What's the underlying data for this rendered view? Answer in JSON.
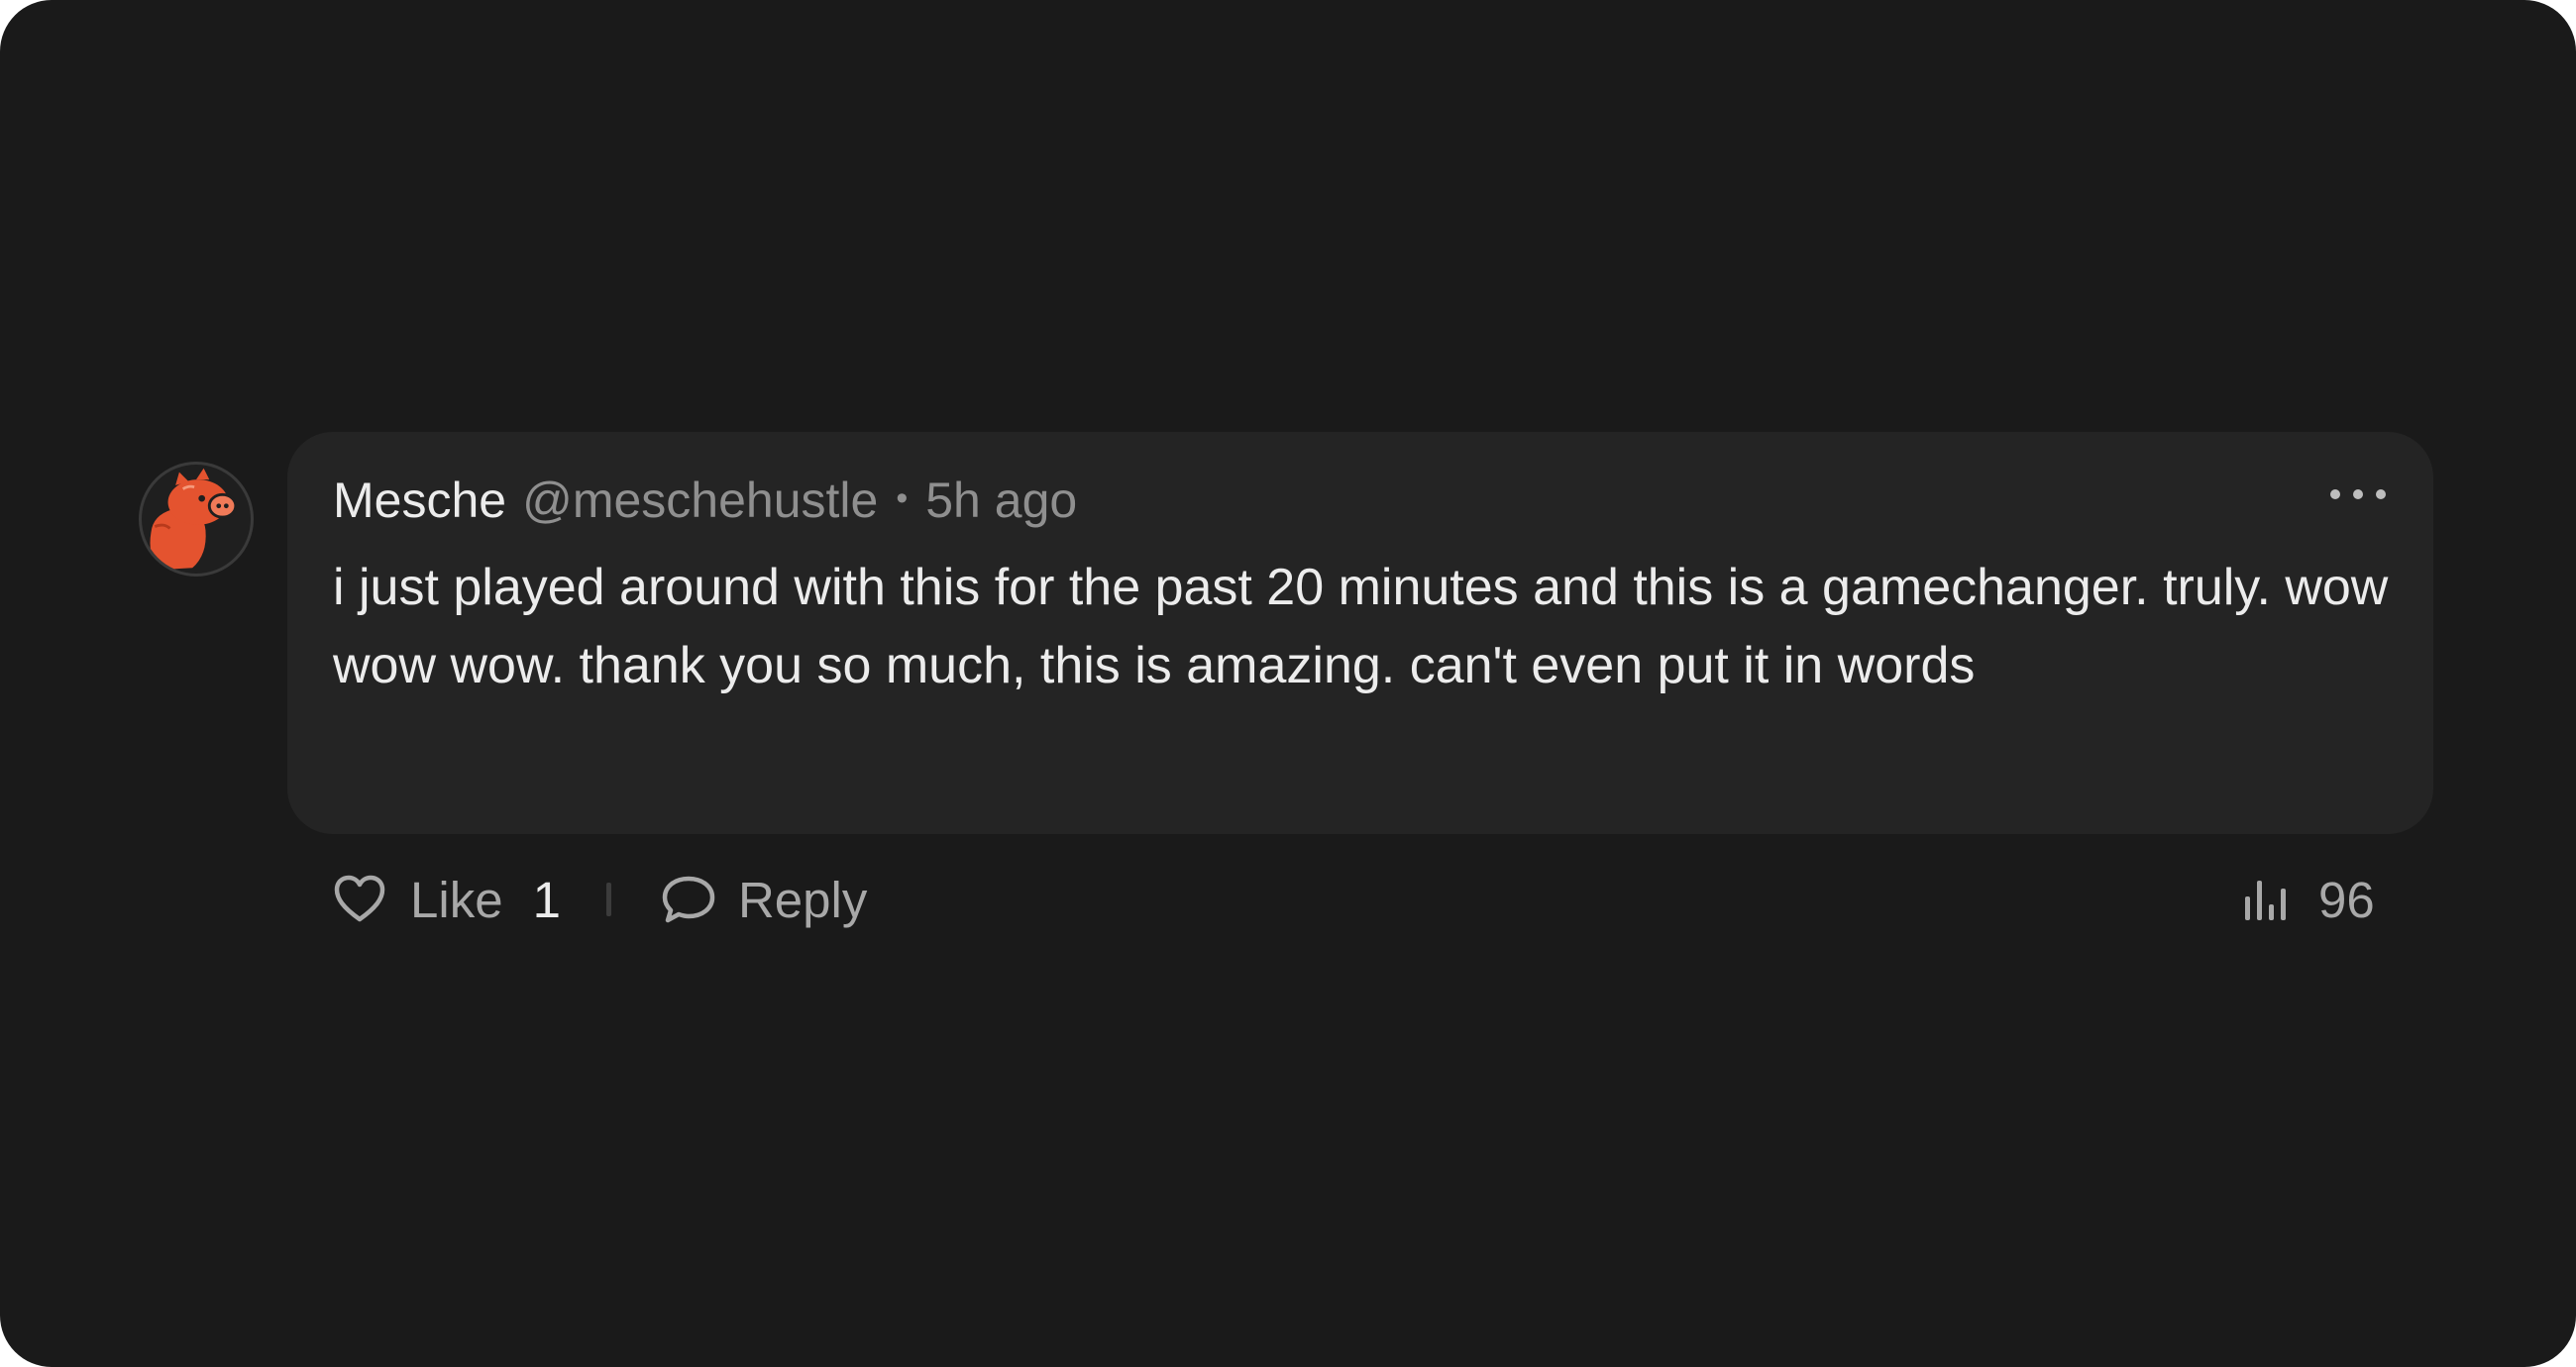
{
  "comment": {
    "author_name": "Mesche",
    "author_handle": "@meschehustle",
    "separator": "•",
    "timestamp": "5h ago",
    "body": "i just played around with this for the past 20 minutes and this is a gamechanger. truly. wow wow wow. thank you so much, this is amazing. can't even put it in words",
    "avatar_icon": "pig-avatar-icon",
    "more_icon": "more-horizontal-icon"
  },
  "actions": {
    "like_icon": "heart-icon",
    "like_label": "Like",
    "like_count": "1",
    "reply_icon": "speech-bubble-icon",
    "reply_label": "Reply",
    "views_icon": "bar-chart-icon",
    "views_count": "96"
  },
  "colors": {
    "background": "#1a1a1a",
    "card": "#242424",
    "text_primary": "#ececec",
    "text_secondary": "#8f8f8f",
    "avatar_accent": "#e4532f"
  }
}
